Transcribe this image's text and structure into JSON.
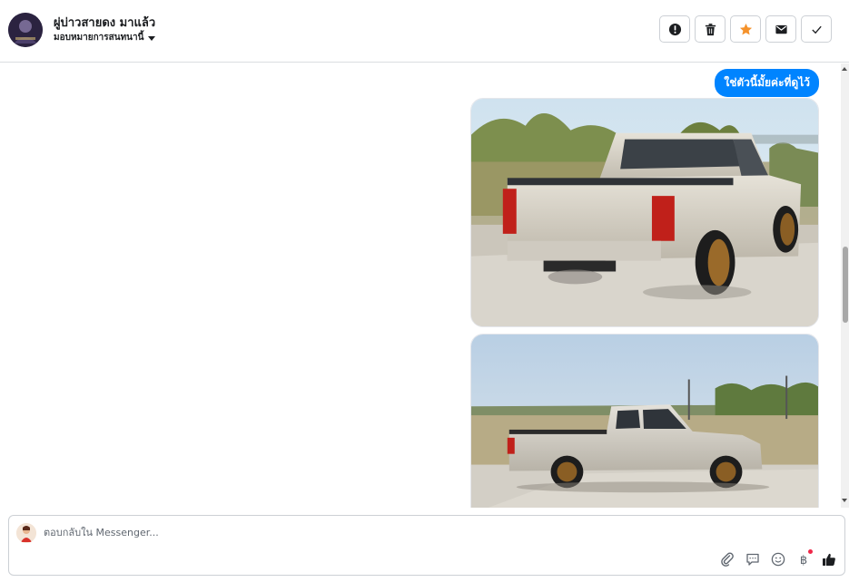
{
  "header": {
    "contact_name": "ผู่บ่าวสายดง มาแล้ว",
    "assign_label": "มอบหมายการสนทนานี้",
    "actions": [
      {
        "name": "report-button",
        "icon": "alert-circle-icon"
      },
      {
        "name": "delete-button",
        "icon": "trash-icon"
      },
      {
        "name": "star-button",
        "icon": "star-icon"
      },
      {
        "name": "mark-unread-button",
        "icon": "envelope-icon"
      },
      {
        "name": "mark-done-button",
        "icon": "checkmark-icon"
      }
    ]
  },
  "thread": {
    "message_text": "ใช่ตัวนี้มั้ยค่ะที่ดูไว้",
    "attachments": [
      {
        "description": "silver pickup truck rear view",
        "icon": "photo-truck-rear"
      },
      {
        "description": "silver pickup truck side view",
        "icon": "photo-truck-side"
      }
    ]
  },
  "composer": {
    "placeholder": "ตอบกลับใน Messenger...",
    "tools": [
      "attachment-icon",
      "saved-reply-icon",
      "emoji-icon",
      "baht-payment-icon",
      "like-icon"
    ]
  },
  "colors": {
    "bubble": "#0084ff",
    "star": "#f5922b",
    "border": "#ccd0d5",
    "notification_dot": "#f02849"
  }
}
